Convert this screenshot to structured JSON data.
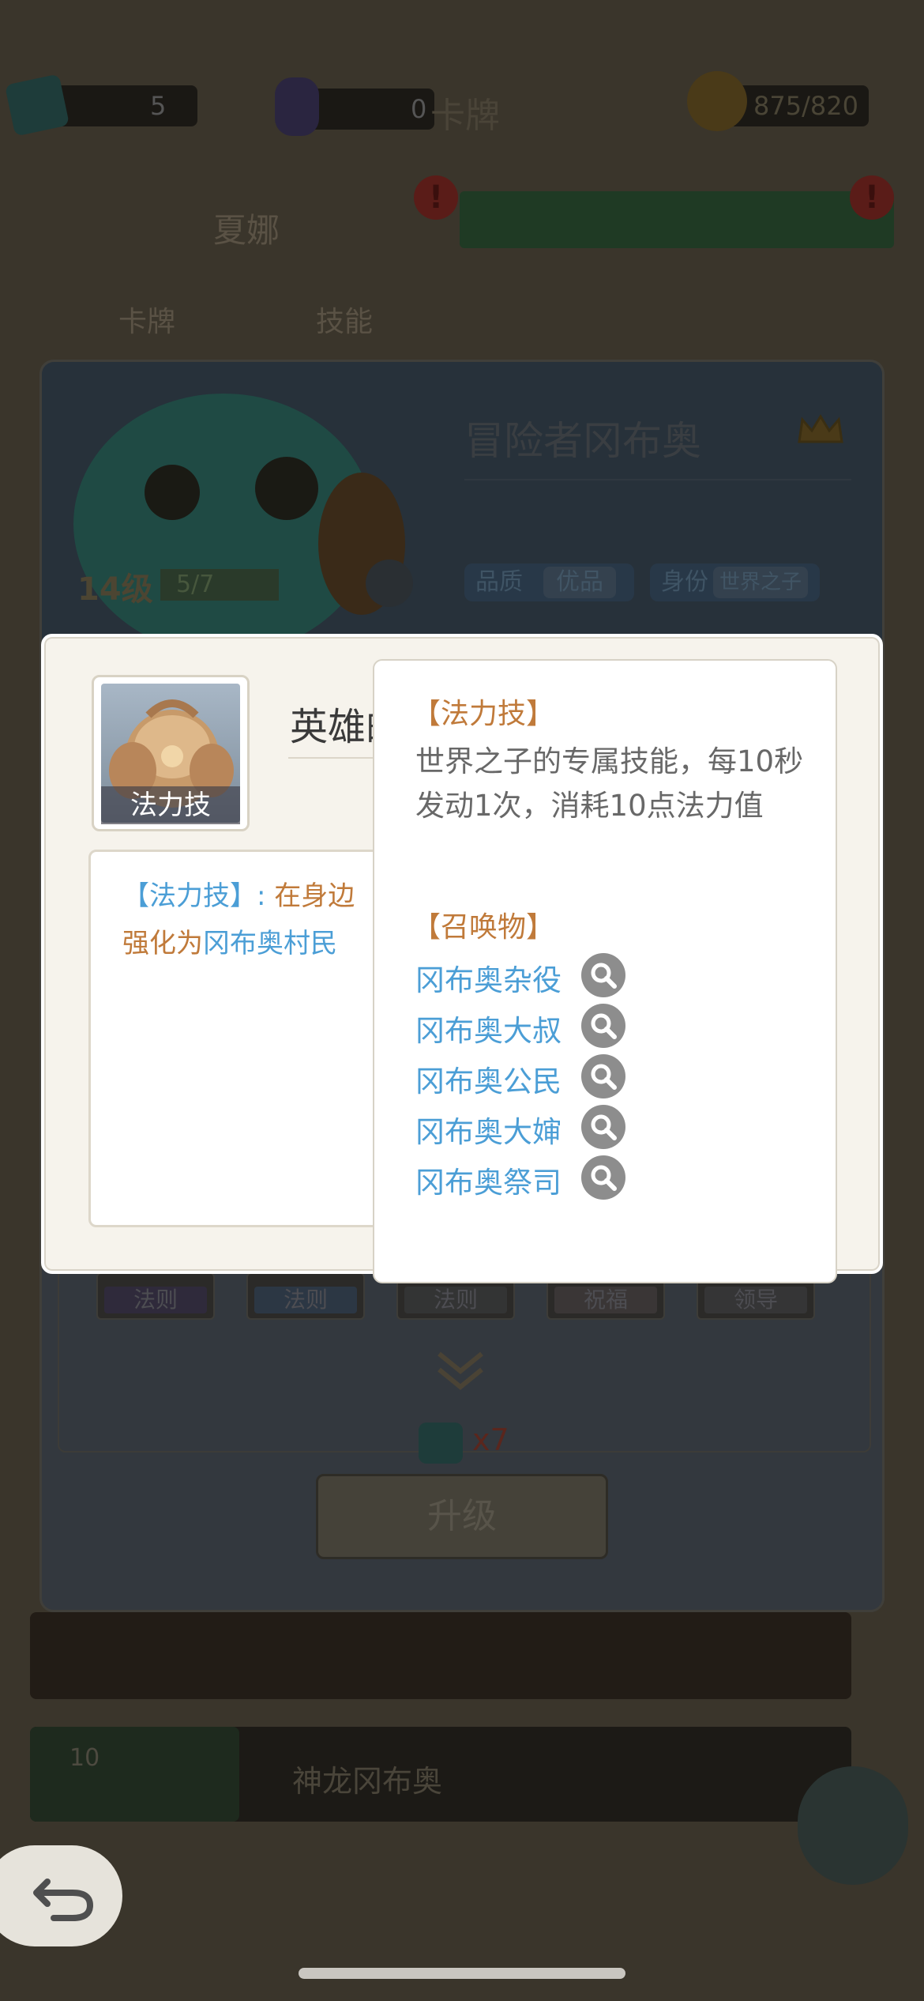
{
  "top_bar": {
    "book_count": "5",
    "gem_count": "0",
    "cards_label": "卡牌",
    "energy": "875/820"
  },
  "header_tabs": {
    "hero_name": "夏娜",
    "sub_tab_cards": "卡牌",
    "sub_tab_skills": "技能"
  },
  "card": {
    "title": "冒险者冈布奥",
    "level": "14级",
    "progress": "5/7",
    "quality_label": "品质",
    "quality_value": "优品",
    "identity_label": "身份",
    "identity_value": "世界之子",
    "tags": [
      "法则",
      "法则",
      "法则",
      "祝福",
      "领导"
    ],
    "upgrade_cost": "x7",
    "upgrade_label": "升级"
  },
  "list": {
    "row2_name": "神龙冈布奥",
    "row2_level": "10"
  },
  "skill_dialog": {
    "icon_label": "法力技",
    "name": "英雄的",
    "desc_prefix": "【法力技】:",
    "desc_text_1": "在身边",
    "desc_text_2a": "强化为",
    "desc_link": "冈布奥村民"
  },
  "tooltip": {
    "section1_title": "【法力技】",
    "section1_body": "世界之子的专属技能，每10秒发动1次，消耗10点法力值",
    "section2_title": "【召唤物】",
    "summons": [
      "冈布奥杂役",
      "冈布奥大叔",
      "冈布奥公民",
      "冈布奥大婶",
      "冈布奥祭司"
    ]
  },
  "colors": {
    "accent_orange": "#c07a3a",
    "link_blue": "#4b9ed6",
    "body_gray": "#686868"
  }
}
